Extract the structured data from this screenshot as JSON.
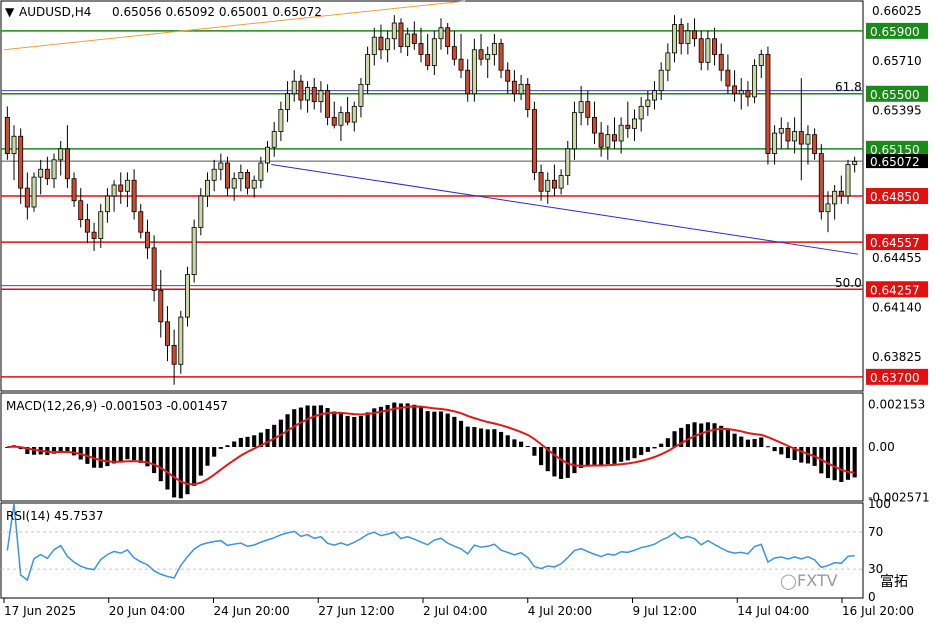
{
  "header": {
    "symbol": "AUDUSD,H4",
    "ohlc": "0.65056 0.65092 0.65001 0.65072",
    "macd_label": "MACD(12,26,9) -0.001503 -0.001457",
    "rsi_label": "RSI(14) 45.7537"
  },
  "fib_labels": {
    "f618": "61.8",
    "f50": "50.0"
  },
  "watermark": {
    "text": "FXTV",
    "cn": "富拓"
  },
  "colors": {
    "bull_candle": "#c9d9a6",
    "bear_candle": "#cc4a2e",
    "support_line": "#e01010",
    "resistance_line": "#1a8a1a",
    "trend_line": "#2b2bc8",
    "fib_line": "#4a4aa8",
    "macd_signal": "#e01a1a",
    "rsi_line": "#3a94e0",
    "current_price_box": "#000000"
  },
  "chart_data": [
    {
      "type": "candlestick",
      "symbol": "AUDUSD",
      "timeframe": "H4",
      "price_axis_ticks": [
        0.66025,
        0.6571,
        0.65395,
        0.65072,
        0.64455,
        0.6414,
        0.63825
      ],
      "ylim": [
        0.6361,
        0.6609
      ],
      "x_tick_labels": [
        "17 Jun 2025",
        "20 Jun 04:00",
        "24 Jun 20:00",
        "27 Jun 12:00",
        "2 Jul 04:00",
        "4 Jul 20:00",
        "9 Jul 12:00",
        "14 Jul 04:00",
        "16 Jul 20:00"
      ],
      "horizontal_levels": [
        {
          "value": 0.659,
          "label": "0.65900",
          "kind": "resistance"
        },
        {
          "value": 0.655,
          "label": "0.65500",
          "kind": "resistance"
        },
        {
          "value": 0.6515,
          "label": "0.65150",
          "kind": "resistance"
        },
        {
          "value": 0.6485,
          "label": "0.64850",
          "kind": "support"
        },
        {
          "value": 0.64557,
          "label": "0.64557",
          "kind": "support"
        },
        {
          "value": 0.64257,
          "label": "0.64257",
          "kind": "support"
        },
        {
          "value": 0.637,
          "label": "0.63700",
          "kind": "support"
        }
      ],
      "fib_levels": [
        {
          "value": 0.6552,
          "label": "61.8"
        },
        {
          "value": 0.6428,
          "label": "50.0"
        }
      ],
      "current_price": {
        "value": 0.65072,
        "label": "0.65072"
      },
      "trendlines": [
        {
          "from": [
            0.313,
            0.6505
          ],
          "to": [
            1.0,
            0.6448
          ],
          "color": "blue"
        },
        {
          "from": [
            0.0,
            0.6578
          ],
          "to": [
            0.54,
            0.6609
          ],
          "color": "orange"
        }
      ],
      "candles": [
        [
          0.6535,
          0.6542,
          0.6508,
          0.6512
        ],
        [
          0.6512,
          0.653,
          0.6495,
          0.6523
        ],
        [
          0.6523,
          0.6528,
          0.648,
          0.649
        ],
        [
          0.649,
          0.65,
          0.647,
          0.6478
        ],
        [
          0.6478,
          0.65,
          0.6475,
          0.6497
        ],
        [
          0.6497,
          0.6508,
          0.6486,
          0.6502
        ],
        [
          0.6502,
          0.651,
          0.6492,
          0.6496
        ],
        [
          0.6496,
          0.6512,
          0.649,
          0.6508
        ],
        [
          0.6508,
          0.652,
          0.6498,
          0.6515
        ],
        [
          0.6515,
          0.653,
          0.649,
          0.6496
        ],
        [
          0.6496,
          0.65,
          0.6478,
          0.6482
        ],
        [
          0.6482,
          0.649,
          0.6465,
          0.647
        ],
        [
          0.647,
          0.648,
          0.6455,
          0.6462
        ],
        [
          0.6462,
          0.6468,
          0.645,
          0.6458
        ],
        [
          0.6458,
          0.648,
          0.6452,
          0.6475
        ],
        [
          0.6475,
          0.649,
          0.6468,
          0.6485
        ],
        [
          0.6485,
          0.6495,
          0.6475,
          0.6492
        ],
        [
          0.6492,
          0.65,
          0.648,
          0.6488
        ],
        [
          0.6488,
          0.65,
          0.6478,
          0.6495
        ],
        [
          0.6495,
          0.6502,
          0.647,
          0.6475
        ],
        [
          0.6475,
          0.648,
          0.6458,
          0.6462
        ],
        [
          0.6462,
          0.647,
          0.6445,
          0.6452
        ],
        [
          0.6452,
          0.646,
          0.6418,
          0.6425
        ],
        [
          0.6425,
          0.6438,
          0.6395,
          0.6405
        ],
        [
          0.6405,
          0.6415,
          0.638,
          0.639
        ],
        [
          0.639,
          0.64,
          0.6365,
          0.6378
        ],
        [
          0.6378,
          0.6412,
          0.6372,
          0.6408
        ],
        [
          0.6408,
          0.644,
          0.6402,
          0.6435
        ],
        [
          0.6435,
          0.647,
          0.643,
          0.6465
        ],
        [
          0.6465,
          0.649,
          0.646,
          0.6485
        ],
        [
          0.6485,
          0.65,
          0.6478,
          0.6495
        ],
        [
          0.6495,
          0.6508,
          0.6488,
          0.6502
        ],
        [
          0.6502,
          0.6512,
          0.6495,
          0.6506
        ],
        [
          0.6506,
          0.651,
          0.6485,
          0.649
        ],
        [
          0.649,
          0.65,
          0.6482,
          0.6496
        ],
        [
          0.6496,
          0.6505,
          0.6488,
          0.65
        ],
        [
          0.65,
          0.6502,
          0.6486,
          0.649
        ],
        [
          0.649,
          0.6498,
          0.6484,
          0.6495
        ],
        [
          0.6495,
          0.651,
          0.649,
          0.6506
        ],
        [
          0.6506,
          0.652,
          0.65,
          0.6516
        ],
        [
          0.6516,
          0.6532,
          0.651,
          0.6526
        ],
        [
          0.6526,
          0.6545,
          0.652,
          0.654
        ],
        [
          0.654,
          0.6558,
          0.6532,
          0.655
        ],
        [
          0.655,
          0.6565,
          0.6545,
          0.6558
        ],
        [
          0.6558,
          0.6562,
          0.654,
          0.6546
        ],
        [
          0.6546,
          0.6558,
          0.6538,
          0.6554
        ],
        [
          0.6554,
          0.656,
          0.654,
          0.6545
        ],
        [
          0.6545,
          0.6558,
          0.6538,
          0.6552
        ],
        [
          0.6552,
          0.6556,
          0.653,
          0.6535
        ],
        [
          0.6535,
          0.6545,
          0.6528,
          0.653
        ],
        [
          0.653,
          0.6542,
          0.652,
          0.6538
        ],
        [
          0.6538,
          0.6548,
          0.653,
          0.6532
        ],
        [
          0.6532,
          0.6545,
          0.6526,
          0.6542
        ],
        [
          0.6542,
          0.656,
          0.6535,
          0.6556
        ],
        [
          0.6556,
          0.658,
          0.655,
          0.6575
        ],
        [
          0.6575,
          0.6592,
          0.6568,
          0.6586
        ],
        [
          0.6586,
          0.6594,
          0.6572,
          0.6578
        ],
        [
          0.6578,
          0.659,
          0.657,
          0.6585
        ],
        [
          0.6585,
          0.66,
          0.6578,
          0.6595
        ],
        [
          0.6595,
          0.6598,
          0.6576,
          0.658
        ],
        [
          0.658,
          0.6592,
          0.6574,
          0.6588
        ],
        [
          0.6588,
          0.6596,
          0.6578,
          0.6582
        ],
        [
          0.6582,
          0.6592,
          0.657,
          0.6575
        ],
        [
          0.6575,
          0.6588,
          0.6565,
          0.6568
        ],
        [
          0.6568,
          0.659,
          0.6562,
          0.6585
        ],
        [
          0.6585,
          0.6598,
          0.6578,
          0.6592
        ],
        [
          0.6592,
          0.6595,
          0.6575,
          0.658
        ],
        [
          0.658,
          0.659,
          0.6568,
          0.6572
        ],
        [
          0.6572,
          0.6588,
          0.656,
          0.6565
        ],
        [
          0.6565,
          0.6572,
          0.6545,
          0.655
        ],
        [
          0.655,
          0.6585,
          0.6545,
          0.6578
        ],
        [
          0.6578,
          0.6588,
          0.6568,
          0.6572
        ],
        [
          0.6572,
          0.658,
          0.656,
          0.6575
        ],
        [
          0.6575,
          0.6588,
          0.6568,
          0.6582
        ],
        [
          0.6582,
          0.6585,
          0.656,
          0.6565
        ],
        [
          0.6565,
          0.657,
          0.655,
          0.6558
        ],
        [
          0.6558,
          0.6565,
          0.6545,
          0.655
        ],
        [
          0.655,
          0.6562,
          0.6546,
          0.6556
        ],
        [
          0.6556,
          0.656,
          0.6535,
          0.654
        ],
        [
          0.654,
          0.6545,
          0.6495,
          0.65
        ],
        [
          0.65,
          0.6505,
          0.6482,
          0.6488
        ],
        [
          0.6488,
          0.65,
          0.648,
          0.6495
        ],
        [
          0.6495,
          0.6505,
          0.6485,
          0.649
        ],
        [
          0.649,
          0.6502,
          0.6486,
          0.6498
        ],
        [
          0.6498,
          0.652,
          0.6492,
          0.6515
        ],
        [
          0.6515,
          0.6545,
          0.6508,
          0.6538
        ],
        [
          0.6538,
          0.6555,
          0.653,
          0.6545
        ],
        [
          0.6545,
          0.6552,
          0.653,
          0.6535
        ],
        [
          0.6535,
          0.6545,
          0.6518,
          0.6525
        ],
        [
          0.6525,
          0.6532,
          0.651,
          0.6516
        ],
        [
          0.6516,
          0.653,
          0.6508,
          0.6524
        ],
        [
          0.6524,
          0.6535,
          0.6515,
          0.652
        ],
        [
          0.652,
          0.6535,
          0.6512,
          0.653
        ],
        [
          0.653,
          0.6545,
          0.6522,
          0.6528
        ],
        [
          0.6528,
          0.654,
          0.652,
          0.6534
        ],
        [
          0.6534,
          0.6548,
          0.6526,
          0.6542
        ],
        [
          0.6542,
          0.6552,
          0.6536,
          0.6546
        ],
        [
          0.6546,
          0.6558,
          0.654,
          0.6552
        ],
        [
          0.6552,
          0.657,
          0.6546,
          0.6565
        ],
        [
          0.6565,
          0.6582,
          0.6558,
          0.6576
        ],
        [
          0.6576,
          0.66,
          0.657,
          0.6594
        ],
        [
          0.6594,
          0.6598,
          0.6575,
          0.6582
        ],
        [
          0.6582,
          0.6595,
          0.6575,
          0.659
        ],
        [
          0.659,
          0.6598,
          0.658,
          0.6585
        ],
        [
          0.6585,
          0.659,
          0.6565,
          0.657
        ],
        [
          0.657,
          0.659,
          0.6565,
          0.6585
        ],
        [
          0.6585,
          0.6592,
          0.6568,
          0.6575
        ],
        [
          0.6575,
          0.6582,
          0.6558,
          0.6565
        ],
        [
          0.6565,
          0.6575,
          0.655,
          0.6555
        ],
        [
          0.6555,
          0.6565,
          0.6545,
          0.655
        ],
        [
          0.655,
          0.656,
          0.654,
          0.6552
        ],
        [
          0.6552,
          0.6558,
          0.6542,
          0.6548
        ],
        [
          0.6548,
          0.6572,
          0.6544,
          0.6568
        ],
        [
          0.6568,
          0.6578,
          0.656,
          0.6575
        ],
        [
          0.6575,
          0.658,
          0.6505,
          0.6512
        ],
        [
          0.6512,
          0.653,
          0.6505,
          0.6525
        ],
        [
          0.6525,
          0.6535,
          0.6515,
          0.6528
        ],
        [
          0.6528,
          0.6532,
          0.6515,
          0.652
        ],
        [
          0.652,
          0.6535,
          0.6512,
          0.6526
        ],
        [
          0.6526,
          0.656,
          0.6495,
          0.6518
        ],
        [
          0.6518,
          0.653,
          0.6505,
          0.6524
        ],
        [
          0.6524,
          0.6528,
          0.6508,
          0.6512
        ],
        [
          0.6512,
          0.6518,
          0.647,
          0.6475
        ],
        [
          0.6475,
          0.6488,
          0.6462,
          0.648
        ],
        [
          0.648,
          0.6492,
          0.647,
          0.6488
        ],
        [
          0.6488,
          0.6498,
          0.648,
          0.6485
        ],
        [
          0.6485,
          0.6508,
          0.648,
          0.6505
        ],
        [
          0.6505,
          0.651,
          0.65,
          0.6507
        ]
      ]
    },
    {
      "type": "bar",
      "indicator": "MACD(12,26,9)",
      "main_value": -0.001503,
      "signal_value": -0.001457,
      "axis_ticks": [
        0.002153,
        0.0,
        -0.002571
      ],
      "ylim": [
        -0.0027,
        0.0027
      ]
    },
    {
      "type": "line",
      "indicator": "RSI(14)",
      "last_value": 45.7537,
      "axis_ticks": [
        100,
        70,
        30,
        0
      ],
      "levels": [
        70,
        30
      ],
      "ylim": [
        0,
        100
      ]
    }
  ]
}
